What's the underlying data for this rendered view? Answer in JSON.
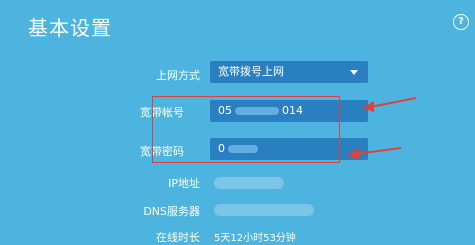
{
  "page": {
    "title": "基本设置",
    "help_symbol": "?"
  },
  "form": {
    "connection_type": {
      "label": "上网方式",
      "value": "宽带拨号上网"
    },
    "account": {
      "label": "宽带帐号",
      "value_prefix": "05",
      "value_suffix": "014"
    },
    "password": {
      "label": "宽带密码",
      "value_prefix": "0"
    },
    "ip_address": {
      "label": "IP地址"
    },
    "dns_server": {
      "label": "DNS服务器"
    },
    "online_time": {
      "label": "在线时长",
      "value": "5天12小时53分钟"
    }
  },
  "colors": {
    "background": "#4cb4de",
    "field": "#2a7fc1",
    "annotation": "#d9443b"
  },
  "icons": {
    "help": "help-circle-icon",
    "dropdown": "caret-down-icon",
    "annotation_arrow": "red-arrow-icon"
  }
}
